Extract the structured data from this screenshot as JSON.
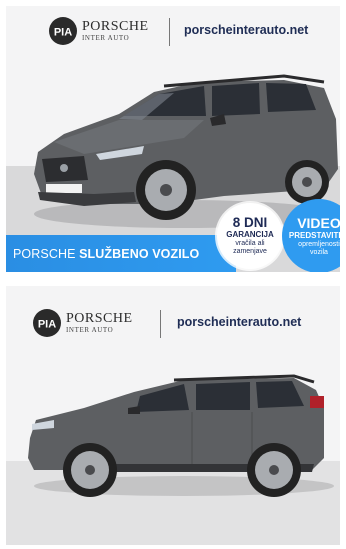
{
  "colors": {
    "accent_blue": "#2f9bf0",
    "dark_navy": "#1f2d55",
    "car_body": "#5a5c5f"
  },
  "listing_image_1": {
    "brand": {
      "name": "PORSCHE",
      "sub": "INTER AUTO",
      "logo_letters": "PIA"
    },
    "website": "porscheinterauto.net",
    "ribbon": {
      "prefix": "PORSCHE ",
      "bold": "SLUŽBENO VOZILO"
    },
    "badge_warranty": {
      "big": "8 DNI",
      "mid": "GARANCIJA",
      "small_1": "vračila ali",
      "small_2": "zamenjave"
    },
    "badge_video": {
      "big": "VIDEO",
      "mid": "PREDSTAVITEV",
      "small_1": "opremljenosti",
      "small_2": "vozila"
    },
    "icons": [
      "pia-logo-icon",
      "car-photo"
    ]
  },
  "listing_image_2": {
    "brand": {
      "name": "PORSCHE",
      "sub": "INTER AUTO",
      "logo_letters": "PIA"
    },
    "website": "porscheinterauto.net",
    "icons": [
      "pia-logo-icon",
      "car-photo"
    ]
  }
}
